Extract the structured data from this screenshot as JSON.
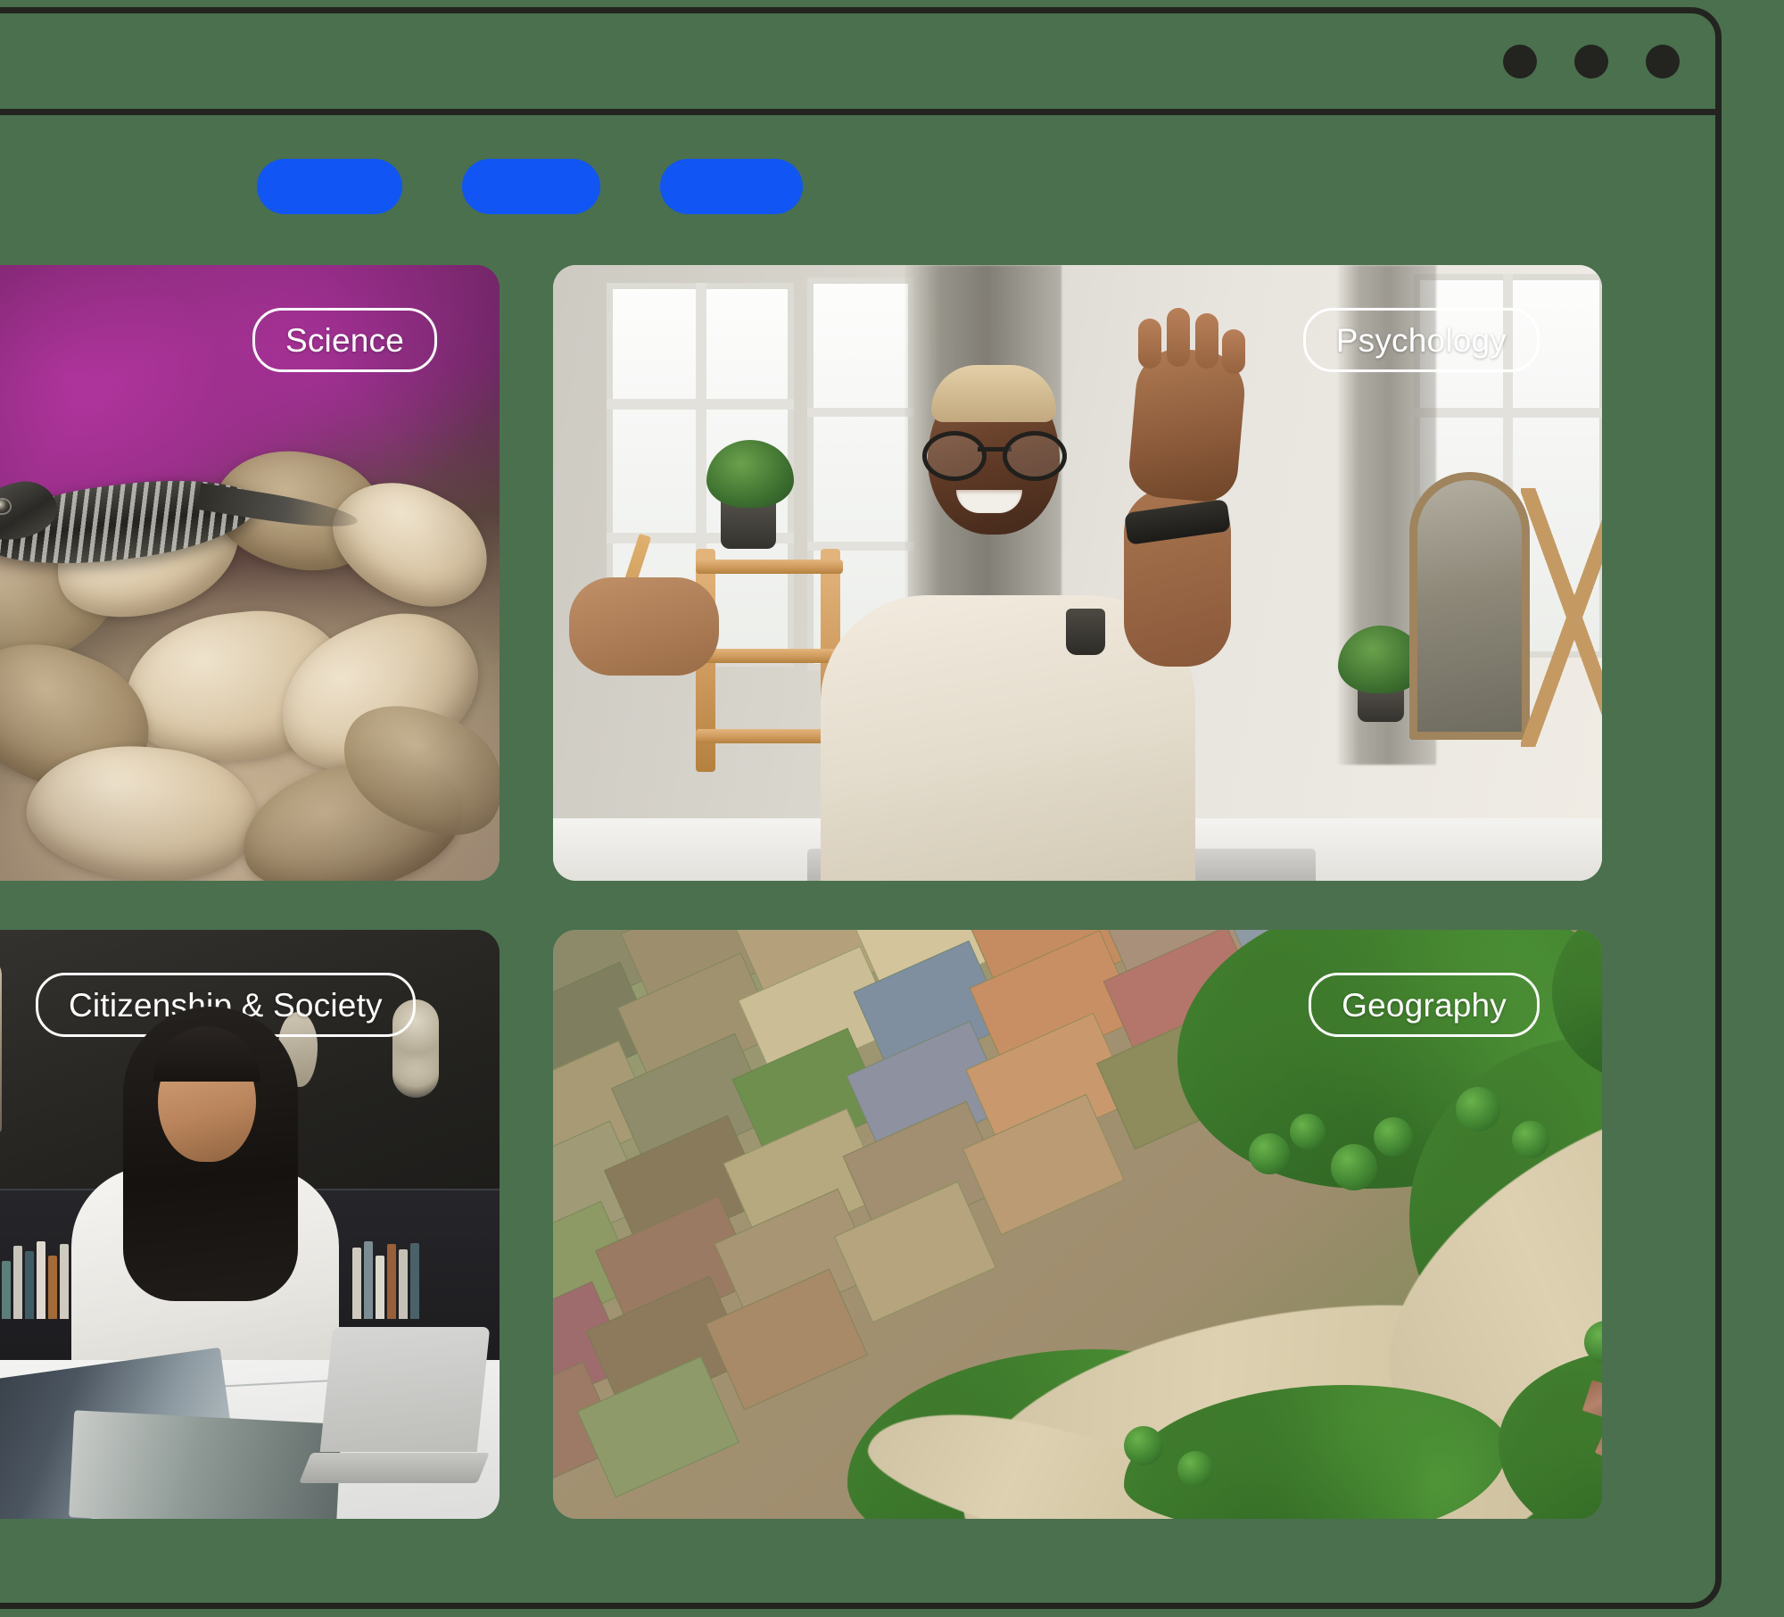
{
  "theme": {
    "page_background": "#4a704e",
    "frame_stroke": "#232320",
    "accent_blue": "#1155f5",
    "chip_border": "#ffffff",
    "chip_text": "#ffffff"
  },
  "browser": {
    "window_controls": [
      {
        "name": "window-dot-1",
        "color": "#232320"
      },
      {
        "name": "window-dot-2",
        "color": "#232320"
      },
      {
        "name": "window-dot-3",
        "color": "#232320"
      }
    ],
    "nav_pills": [
      {
        "name": "nav-pill-1",
        "label": "",
        "color": "#1155f5"
      },
      {
        "name": "nav-pill-2",
        "label": "",
        "color": "#1155f5"
      },
      {
        "name": "nav-pill-3",
        "label": "",
        "color": "#1155f5"
      }
    ]
  },
  "cards": [
    {
      "id": "science",
      "chip_label": "Science",
      "chip_position": "right",
      "image_description": "Close-up macro photo of a wall lizard resting on dried hydrangea petals with a magenta-purple bokeh background"
    },
    {
      "id": "psychology",
      "chip_label": "Psychology",
      "chip_position": "right",
      "image_description": "Smiling man with glasses waving at the camera while seated at a desk in a bright plant-filled room with large windows"
    },
    {
      "id": "society",
      "chip_label": "Citizenship & Society",
      "chip_position": "left",
      "image_description": "Woman in a white shirt reading an open book beside a laptop at a marble desk, dark studio with bookshelves and artefacts behind"
    },
    {
      "id": "geography",
      "chip_label": "Geography",
      "chip_position": "right",
      "image_description": "Aerial drone view of patchwork rice paddies, dense green jungle and a wide tan river curving through the landscape"
    }
  ]
}
